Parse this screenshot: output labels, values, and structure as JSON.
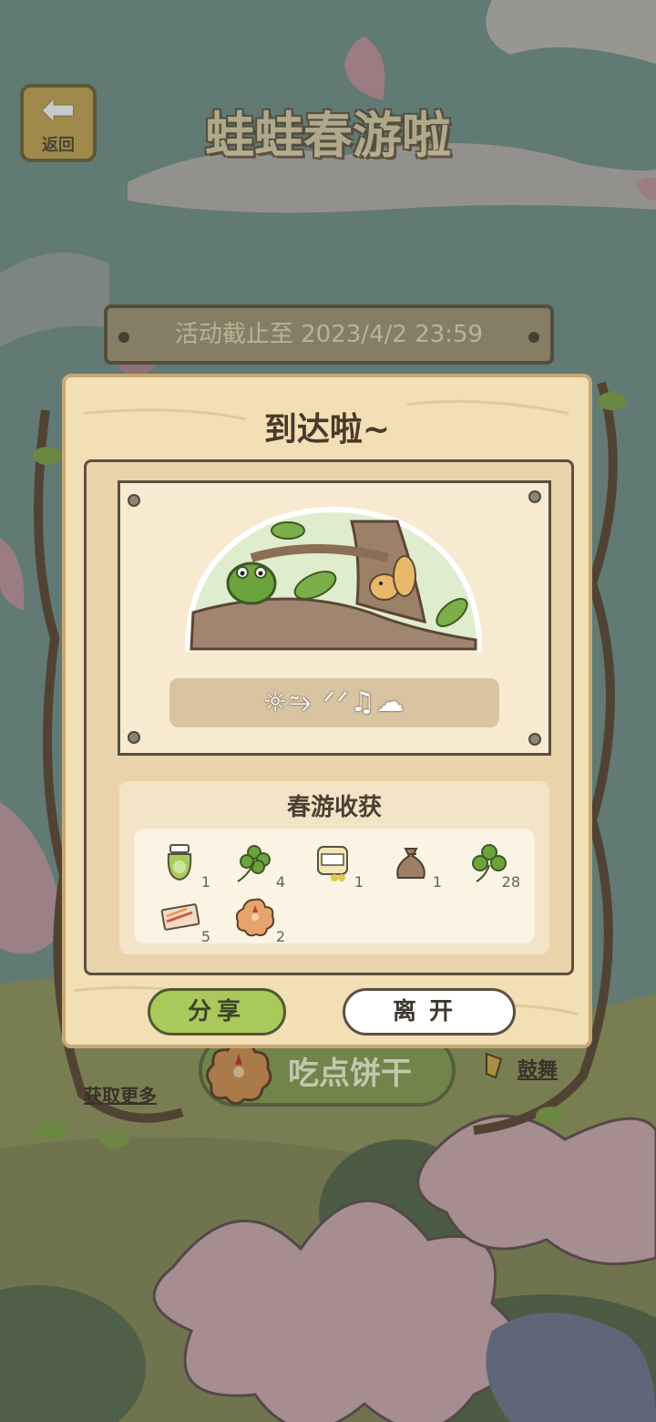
{
  "header": {
    "back_label": "返回",
    "title": "蛙蛙春游啦"
  },
  "event": {
    "deadline_text": "活动截止至 2023/4/2 23:59"
  },
  "behind": {
    "eat_button_label": "吃点饼干",
    "get_more_label": "获取更多",
    "dance_label": "鼓舞"
  },
  "modal": {
    "title": "到达啦~",
    "message_symbols": "☼⥲ ᐟᐟ♫☁",
    "harvest_title": "春游收获",
    "items": [
      {
        "icon": "jar-icon",
        "count": "1"
      },
      {
        "icon": "four-leaf-clover-icon",
        "count": "4"
      },
      {
        "icon": "candy-can-icon",
        "count": "1"
      },
      {
        "icon": "sack-icon",
        "count": "1"
      },
      {
        "icon": "clover-icon",
        "count": "28"
      },
      {
        "icon": "ticket-icon",
        "count": "5"
      },
      {
        "icon": "cookie-icon",
        "count": "2"
      }
    ],
    "share_label": "分享",
    "leave_label": "离开"
  },
  "colors": {
    "sky": "#6f8a84",
    "wood_panel": "#f3dfb6",
    "share_green": "#a9c95a",
    "frog_green": "#6da33c"
  }
}
